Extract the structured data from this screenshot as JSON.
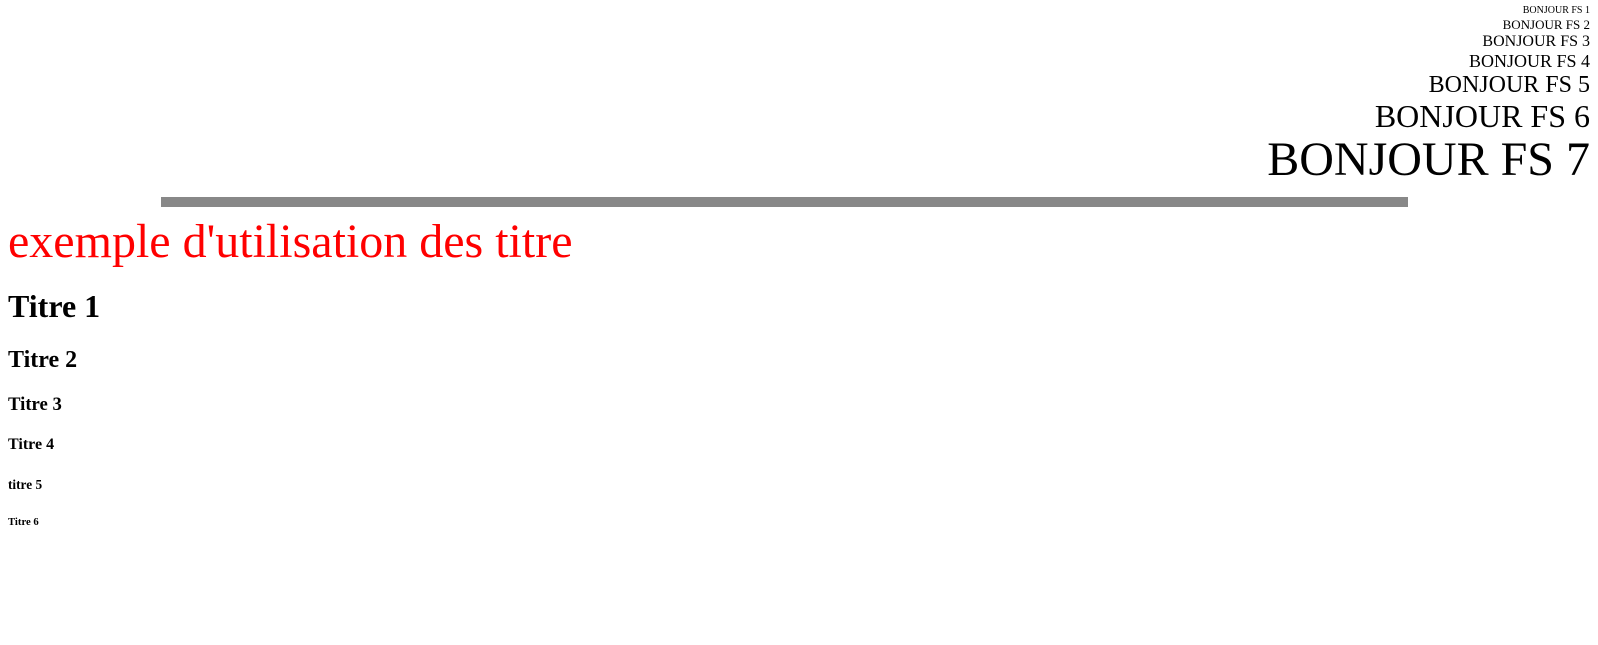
{
  "font_sizes": [
    "BONJOUR FS 1",
    "BONJOUR FS 2",
    "BONJOUR FS 3",
    "BONJOUR FS 4",
    "BONJOUR FS 5",
    "BONJOUR FS 6",
    "BONJOUR FS 7"
  ],
  "colors": {
    "title": "#ff0000",
    "rule": "#888888",
    "text": "#000000",
    "background": "#ffffff"
  },
  "main_title": "exemple d'utilisation des titre",
  "headings": {
    "h1": "Titre 1",
    "h2": "Titre 2",
    "h3": "Titre 3",
    "h4": "Titre 4",
    "h5": "titre 5",
    "h6": "Titre 6"
  }
}
